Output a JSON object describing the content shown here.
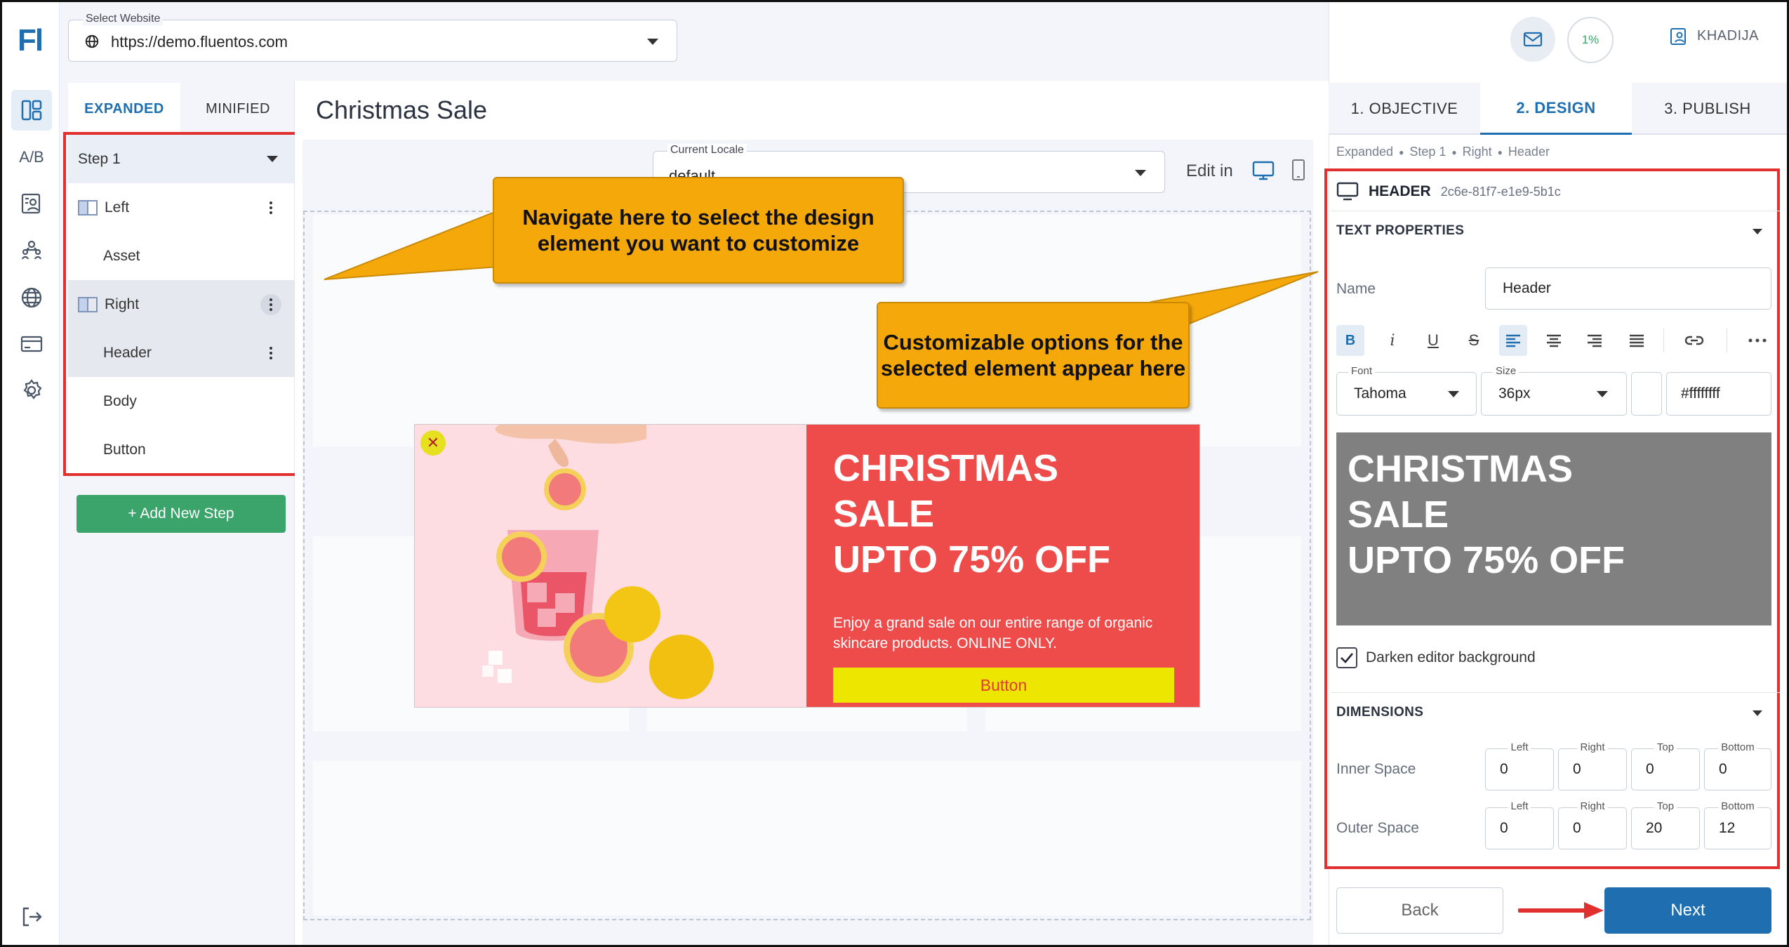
{
  "app": {
    "logo": "Fl"
  },
  "rail": {
    "items": [
      {
        "icon": "layout-icon",
        "active": true
      },
      {
        "icon": "ab-test-icon",
        "label": "A/B"
      },
      {
        "icon": "contacts-icon"
      },
      {
        "icon": "audience-icon"
      },
      {
        "icon": "globe-icon"
      },
      {
        "icon": "card-icon"
      },
      {
        "icon": "gear-icon"
      }
    ],
    "logout_icon": "logout-icon"
  },
  "website_select": {
    "label": "Select Website",
    "value": "https://demo.fluentos.com"
  },
  "steps_panel": {
    "tabs": [
      {
        "label": "EXPANDED",
        "active": true
      },
      {
        "label": "MINIFIED",
        "active": false
      }
    ],
    "step_label": "Step 1",
    "rows": [
      {
        "label": "Left"
      },
      {
        "label": "Asset"
      },
      {
        "label": "Right"
      },
      {
        "label": "Header"
      },
      {
        "label": "Body"
      },
      {
        "label": "Button"
      }
    ],
    "add_step": "+ Add New Step"
  },
  "editor": {
    "title": "Christmas Sale",
    "locale": {
      "label": "Current Locale",
      "value": "default"
    },
    "edit_in": "Edit in"
  },
  "popup": {
    "close": "✕",
    "headline": [
      "CHRISTMAS",
      "SALE",
      "UPTO 75% OFF"
    ],
    "body": "Enjoy a grand sale on our entire range of organic skincare products. ONLINE ONLY.",
    "button": "Button",
    "colors": {
      "left_bg": "#fddde2",
      "right_bg": "#ee4b4b",
      "button_bg": "#ede600"
    }
  },
  "callouts": {
    "left": "Navigate here to select the design element you want to customize",
    "right": "Customizable options for the selected element appear here"
  },
  "header_bar": {
    "progress": "1%",
    "user": "KHADIJA"
  },
  "right_tabs": [
    {
      "label": "1. OBJECTIVE",
      "active": false
    },
    {
      "label": "2. DESIGN",
      "active": true
    },
    {
      "label": "3. PUBLISH",
      "active": false
    }
  ],
  "breadcrumb": [
    "Expanded",
    "Step 1",
    "Right",
    "Header"
  ],
  "element": {
    "type": "HEADER",
    "id": "2c6e-81f7-e1e9-5b1c"
  },
  "text_properties": {
    "title": "TEXT PROPERTIES",
    "name_label": "Name",
    "name_value": "Header",
    "format_buttons": [
      "B",
      "i",
      "U",
      "S",
      "align-left",
      "align-center",
      "align-right",
      "justify",
      "link",
      "more"
    ],
    "font": {
      "label": "Font",
      "value": "Tahoma"
    },
    "size": {
      "label": "Size",
      "value": "36px"
    },
    "color": "#ffffffff",
    "preview": [
      "CHRISTMAS",
      "SALE",
      "UPTO 75% OFF"
    ],
    "darken_label": "Darken editor background",
    "darken_checked": true
  },
  "dimensions": {
    "title": "DIMENSIONS",
    "inner": {
      "label": "Inner Space",
      "left": "0",
      "right": "0",
      "top": "0",
      "bottom": "0"
    },
    "outer": {
      "label": "Outer Space",
      "left": "0",
      "right": "0",
      "top": "20",
      "bottom": "12"
    },
    "field_labels": {
      "left": "Left",
      "right": "Right",
      "top": "Top",
      "bottom": "Bottom"
    }
  },
  "nav": {
    "back": "Back",
    "next": "Next"
  }
}
